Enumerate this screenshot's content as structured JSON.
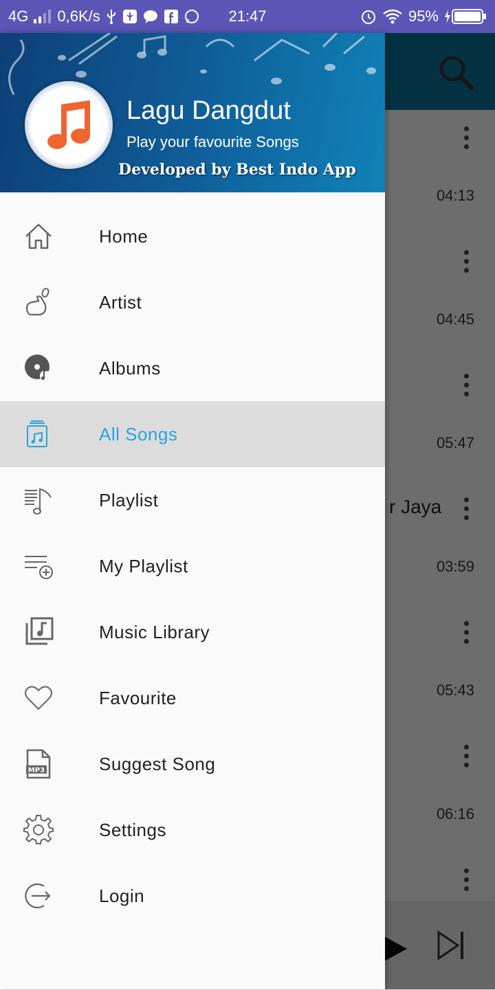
{
  "status_bar": {
    "network": "4G",
    "speed": "0,6K/s",
    "time": "21:47",
    "battery": "95%"
  },
  "drawer": {
    "title": "Lagu Dangdut",
    "subtitle": "Play your favourite Songs",
    "developer": "Developed by Best Indo App",
    "menu": [
      {
        "label": "Home",
        "icon": "home-icon"
      },
      {
        "label": "Artist",
        "icon": "artist-icon"
      },
      {
        "label": "Albums",
        "icon": "album-icon"
      },
      {
        "label": "All Songs",
        "icon": "all-songs-icon",
        "active": true
      },
      {
        "label": "Playlist",
        "icon": "playlist-icon"
      },
      {
        "label": "My Playlist",
        "icon": "playlist-add-icon"
      },
      {
        "label": "Music Library",
        "icon": "music-library-icon"
      },
      {
        "label": "Favourite",
        "icon": "heart-icon"
      },
      {
        "label": "Suggest Song",
        "icon": "mp3-file-icon"
      },
      {
        "label": "Settings",
        "icon": "gear-icon"
      },
      {
        "label": "Login",
        "icon": "login-icon"
      }
    ]
  },
  "song_list": {
    "rows": [
      {
        "title": "",
        "duration": "04:13"
      },
      {
        "title": "",
        "duration": "04:45"
      },
      {
        "title": "",
        "duration": "05:47"
      },
      {
        "title": "r Jaya",
        "duration": "03:59"
      },
      {
        "title": "",
        "duration": "05:43"
      },
      {
        "title": "",
        "duration": "06:16"
      }
    ]
  },
  "colors": {
    "status_bar": "#5b56b5",
    "app_bar": "#0b6f93",
    "active_item_text": "#2aa3e0",
    "active_item_bg": "#dcdcdc",
    "logo_note": "#f06430"
  }
}
